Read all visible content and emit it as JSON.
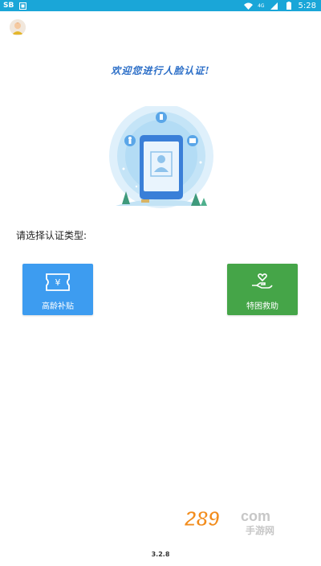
{
  "status_bar": {
    "left_label": "SB",
    "time": "5:28",
    "signal_label": "4G"
  },
  "header": {
    "welcome_text": "欢迎您进行人脸认证!"
  },
  "auth": {
    "prompt": "请选择认证类型:",
    "options": [
      {
        "label": "高龄补贴",
        "icon": "yen-ticket-icon",
        "color": "#3d9cf0"
      },
      {
        "label": "特困救助",
        "icon": "hand-heart-icon",
        "color": "#45a548"
      }
    ]
  },
  "watermark": {
    "brand": "289",
    "domain": "com",
    "sub": "手游网"
  },
  "footer": {
    "version": "3.2.8"
  }
}
